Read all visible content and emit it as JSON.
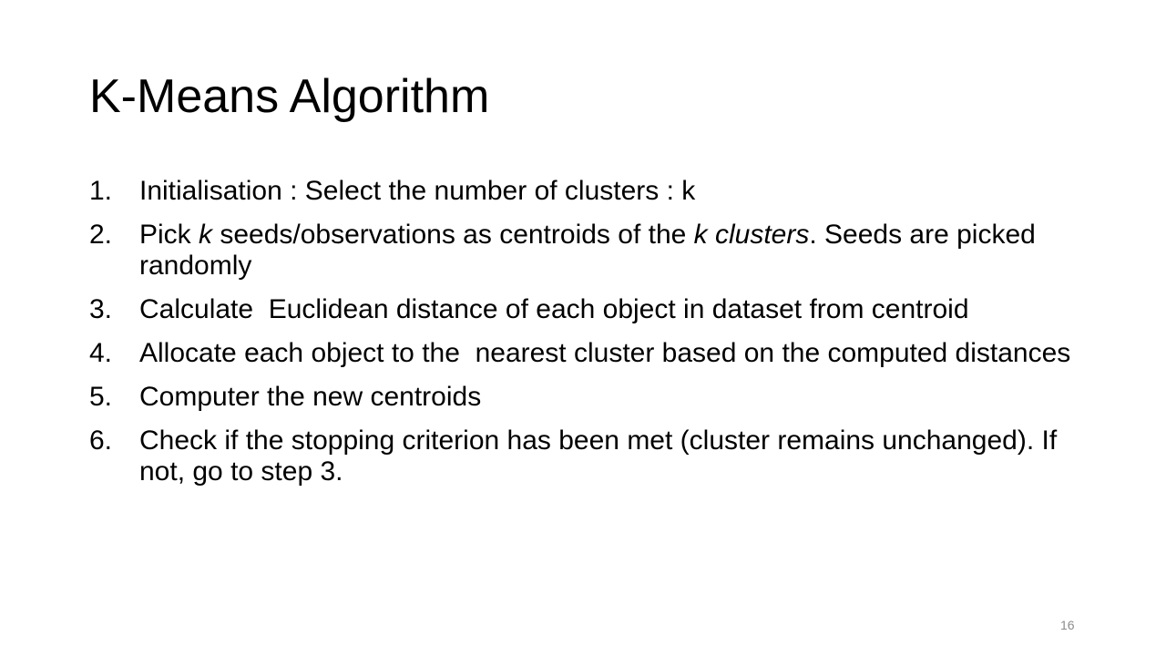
{
  "slide": {
    "title": "K-Means Algorithm",
    "steps": [
      {
        "number": "1.",
        "parts": [
          {
            "text": "Initialisation : Select the number of clusters : k",
            "italic": false
          }
        ]
      },
      {
        "number": "2.",
        "parts": [
          {
            "text": "Pick ",
            "italic": false
          },
          {
            "text": "k",
            "italic": true
          },
          {
            "text": " seeds/observations as centroids of the ",
            "italic": false
          },
          {
            "text": "k clusters",
            "italic": true
          },
          {
            "text": ". Seeds are picked randomly",
            "italic": false
          }
        ]
      },
      {
        "number": "3.",
        "parts": [
          {
            "text": "Calculate  Euclidean distance of each object in dataset from centroid",
            "italic": false
          }
        ]
      },
      {
        "number": "4.",
        "parts": [
          {
            "text": "Allocate each object to the  nearest cluster based on the computed distances",
            "italic": false
          }
        ]
      },
      {
        "number": "5.",
        "parts": [
          {
            "text": "Computer the new centroids",
            "italic": false
          }
        ]
      },
      {
        "number": "6.",
        "parts": [
          {
            "text": "Check if the stopping criterion has been met (cluster remains unchanged). If not, go to step 3.",
            "italic": false
          }
        ]
      }
    ],
    "page_number": "16"
  }
}
